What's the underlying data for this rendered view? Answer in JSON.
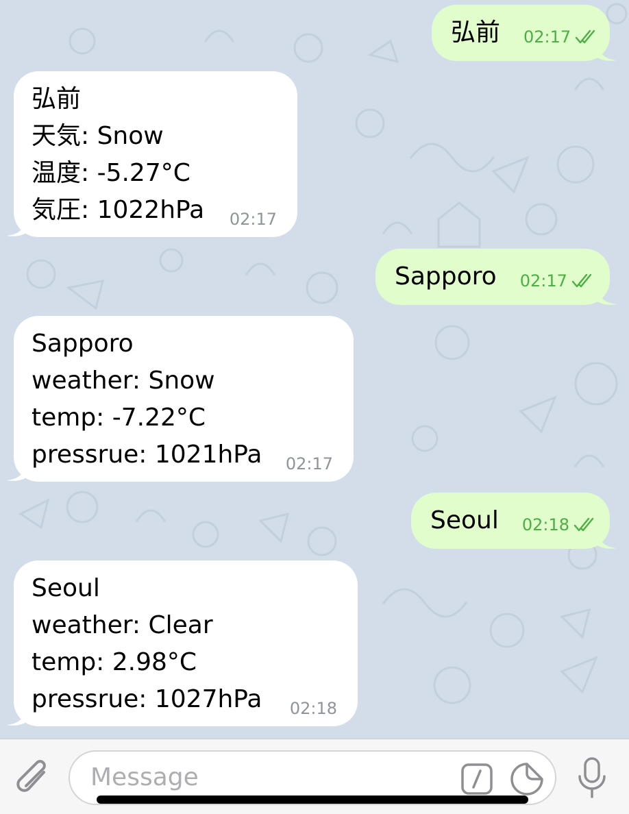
{
  "colors": {
    "background": "#d3dde9",
    "incoming_bubble": "#ffffff",
    "outgoing_bubble": "#e0fdcb",
    "outgoing_time": "#4cae43",
    "incoming_time": "#8e949a"
  },
  "messages": [
    {
      "direction": "outgoing",
      "text": "弘前",
      "time": "02:17",
      "status": "read"
    },
    {
      "direction": "incoming",
      "lines": [
        "弘前",
        "天気: Snow",
        "温度: -5.27°C",
        "気圧: 1022hPa"
      ],
      "time": "02:17"
    },
    {
      "direction": "outgoing",
      "text": "Sapporo",
      "time": "02:17",
      "status": "read"
    },
    {
      "direction": "incoming",
      "lines": [
        "Sapporo",
        "weather: Snow",
        "temp: -7.22°C",
        "pressrue: 1021hPa"
      ],
      "time": "02:17"
    },
    {
      "direction": "outgoing",
      "text": "Seoul",
      "time": "02:18",
      "status": "read"
    },
    {
      "direction": "incoming",
      "lines": [
        "Seoul",
        "weather: Clear",
        "temp: 2.98°C",
        "pressrue: 1027hPa"
      ],
      "time": "02:18"
    }
  ],
  "input_bar": {
    "placeholder": "Message",
    "attach_icon": "paperclip-icon",
    "command_icon": "slash-command-icon",
    "sticker_icon": "sticker-icon",
    "mic_icon": "microphone-icon"
  }
}
